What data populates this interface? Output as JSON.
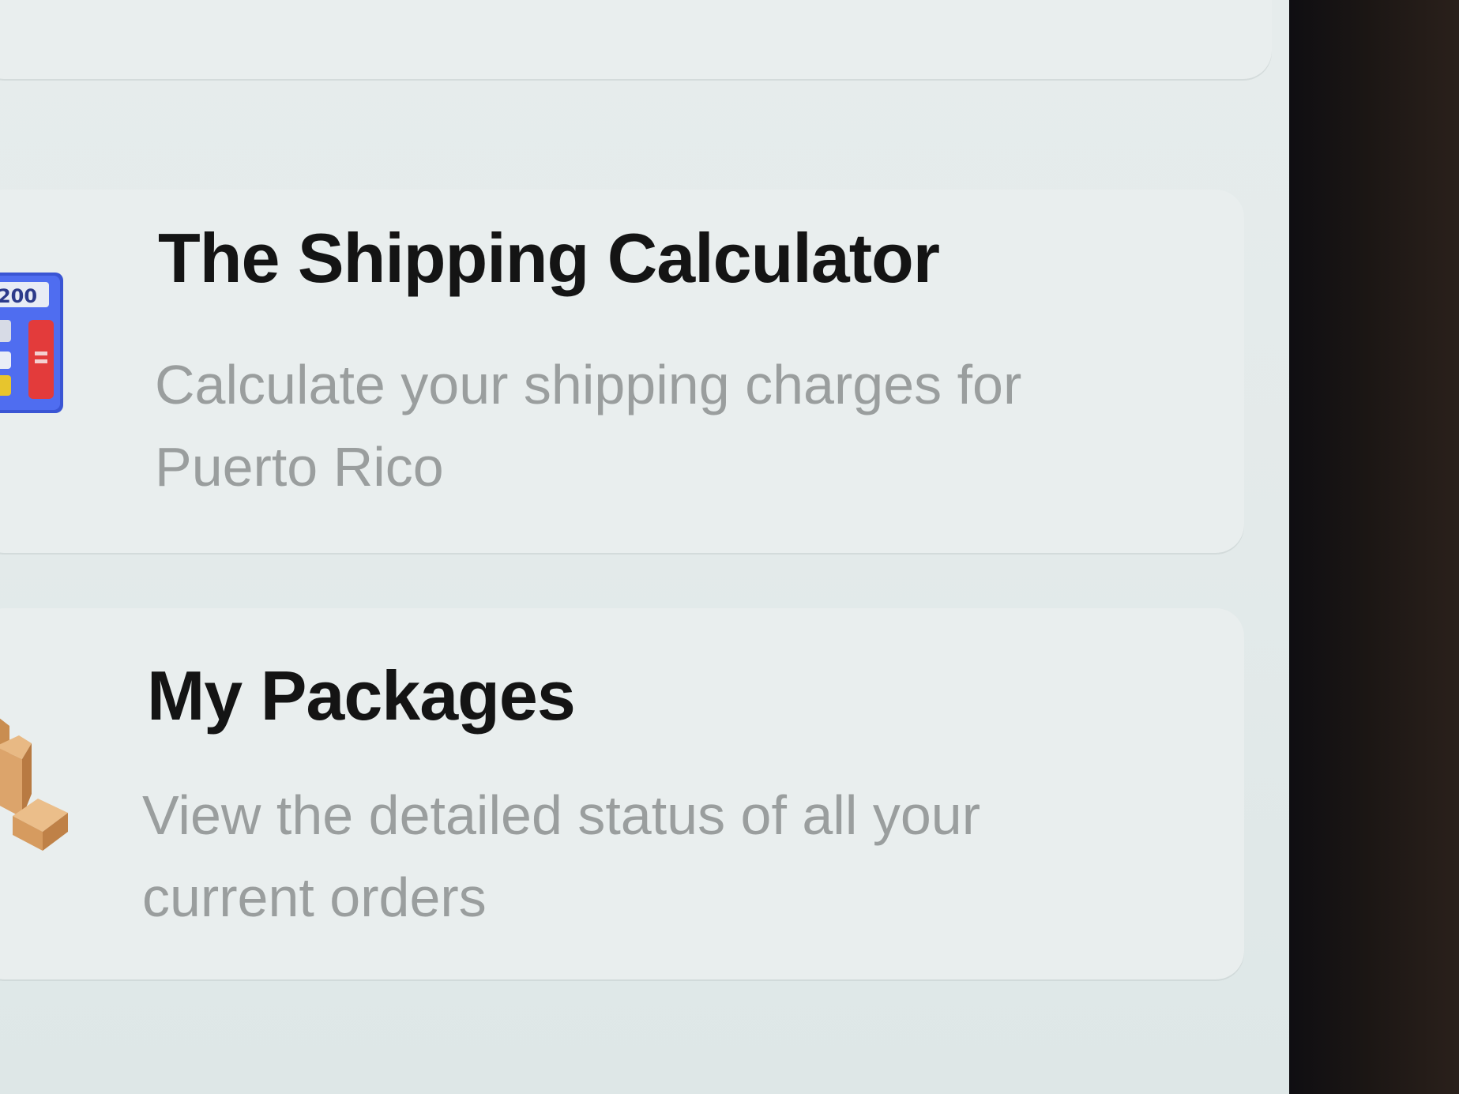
{
  "cards": [
    {
      "title": "The Shipping Calculator",
      "description_line1": "Calculate your shipping charges for",
      "description_line2": "Puerto Rico",
      "icon": "calculator-icon",
      "icon_display": "200"
    },
    {
      "title": "My Packages",
      "description_line1": "View the detailed status of all your",
      "description_line2": "current orders",
      "icon": "packages-icon"
    }
  ],
  "colors": {
    "background": "#e6ecec",
    "card": "#e9eeee",
    "title": "#141414",
    "description": "#9a9e9e",
    "bezel": "#1b1614"
  }
}
